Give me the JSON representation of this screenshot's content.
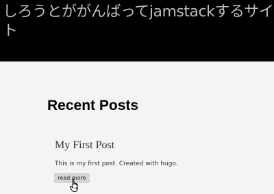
{
  "site": {
    "title": "しろうとががんばってjamstackするサイト"
  },
  "main": {
    "section_title": "Recent Posts",
    "posts": [
      {
        "title": "My First Post",
        "summary": "This is my first post. Created with hugo.",
        "read_more_label": "read more"
      }
    ]
  },
  "cursor": {
    "icon": "hand-pointer-icon"
  },
  "colors": {
    "header_bg": "#000000",
    "header_text": "#bdbdbd",
    "page_bg": "#f4f4f4",
    "button_bg": "#d6d6d6"
  }
}
